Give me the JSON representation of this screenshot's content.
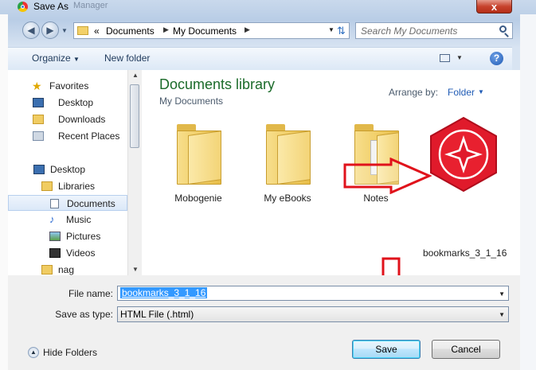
{
  "window": {
    "title": "Save As",
    "ghost_tab": "Manager",
    "close_glyph": "x",
    "icon": "chrome-icon"
  },
  "address_bar": {
    "prefix": "«",
    "crumbs": [
      "Documents",
      "My Documents"
    ],
    "search_placeholder": "Search My Documents"
  },
  "toolbar": {
    "organize": "Organize",
    "new_folder": "New folder",
    "help": "?"
  },
  "nav": {
    "items": [
      {
        "label": "Favorites",
        "icon": "star-icon"
      },
      {
        "label": "Desktop",
        "icon": "desktop-icon"
      },
      {
        "label": "Downloads",
        "icon": "downloads-icon"
      },
      {
        "label": "Recent Places",
        "icon": "recent-places-icon"
      },
      {
        "label": "Desktop",
        "icon": "desktop-icon"
      },
      {
        "label": "Libraries",
        "icon": "libraries-icon"
      },
      {
        "label": "Documents",
        "icon": "document-icon",
        "selected": true
      },
      {
        "label": "Music",
        "icon": "music-icon"
      },
      {
        "label": "Pictures",
        "icon": "pictures-icon"
      },
      {
        "label": "Videos",
        "icon": "videos-icon"
      },
      {
        "label": "nag",
        "icon": "user-folder-icon"
      }
    ]
  },
  "library": {
    "title": "Documents library",
    "subtitle": "My Documents",
    "arrange_label": "Arrange by:",
    "arrange_value": "Folder"
  },
  "files": [
    {
      "label": "Mobogenie",
      "icon": "folder-icon"
    },
    {
      "label": "My eBooks",
      "icon": "folder-icon"
    },
    {
      "label": "Notes",
      "icon": "folder-with-papers-icon"
    },
    {
      "label": "bookmarks_3_1_16",
      "icon": "opera-browser-icon"
    }
  ],
  "form": {
    "file_name_label": "File name:",
    "file_name_value": "bookmarks_3_1_16",
    "save_type_label": "Save as type:",
    "save_type_value": "HTML File (.html)",
    "hide_folders": "Hide Folders",
    "save_button": "Save",
    "cancel_button": "Cancel"
  },
  "colors": {
    "annotation_arrow": "#e0121b",
    "library_title": "#1b6b2a",
    "link": "#1f5bb5"
  }
}
